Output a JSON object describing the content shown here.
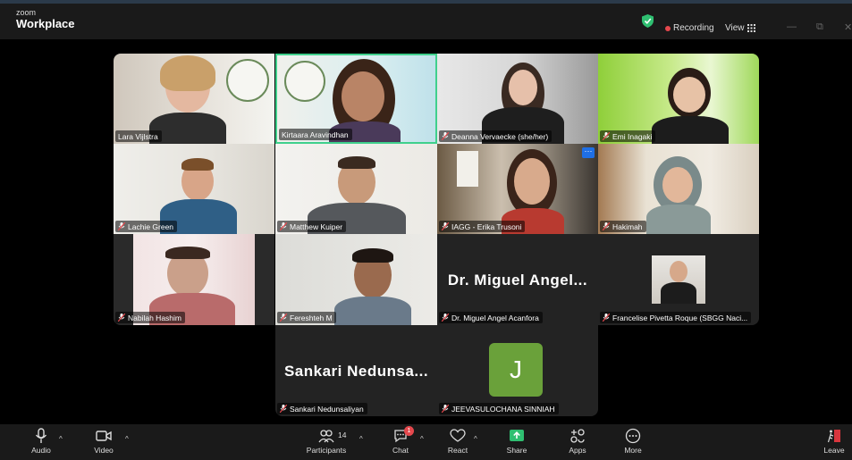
{
  "app": {
    "brand_small": "zoom",
    "brand_big": "Workplace"
  },
  "header": {
    "recording_label": "Recording",
    "view_label": "View",
    "minimize": "—",
    "restore": "⧉",
    "close": "✕"
  },
  "participants": [
    {
      "name": "Lara Vijlstra",
      "muted": false
    },
    {
      "name": "Kirtaara Aravindhan",
      "muted": false,
      "active_speaker": true
    },
    {
      "name": "Deanna Vervaecke (she/her)",
      "muted": true
    },
    {
      "name": "Emi Inagaki",
      "muted": true
    },
    {
      "name": "Lachie Green",
      "muted": true
    },
    {
      "name": "Matthew Kuiper",
      "muted": true
    },
    {
      "name": "IAGG - Erika Trusoni",
      "muted": true,
      "more_badge": "···"
    },
    {
      "name": "Hakimah",
      "muted": true
    },
    {
      "name": "Nabilah Hashim",
      "muted": true
    },
    {
      "name": "Fereshteh M",
      "muted": true
    },
    {
      "name": "Dr. Miguel Angel Acanfora",
      "display": "Dr. Miguel Angel...",
      "muted": true
    },
    {
      "name": "Francelise Pivetta Roque (SBGG Naci...",
      "muted": true
    },
    {
      "name": "Sankari Nedunsaliyan",
      "display": "Sankari Nedunsa...",
      "muted": true
    },
    {
      "name": "JEEVASULOCHANA SINNIAH",
      "avatar_letter": "J",
      "muted": true
    }
  ],
  "toolbar": {
    "audio": "Audio",
    "video": "Video",
    "participants": "Participants",
    "participant_count": "14",
    "chat": "Chat",
    "chat_badge": "1",
    "react": "React",
    "share": "Share",
    "apps": "Apps",
    "more": "More",
    "leave": "Leave",
    "caret": "^"
  },
  "colors": {
    "active_border": "#3fd08c",
    "recording_dot": "#e5484d",
    "share_green": "#2fbf71",
    "avatar_green": "#6aa13a"
  }
}
